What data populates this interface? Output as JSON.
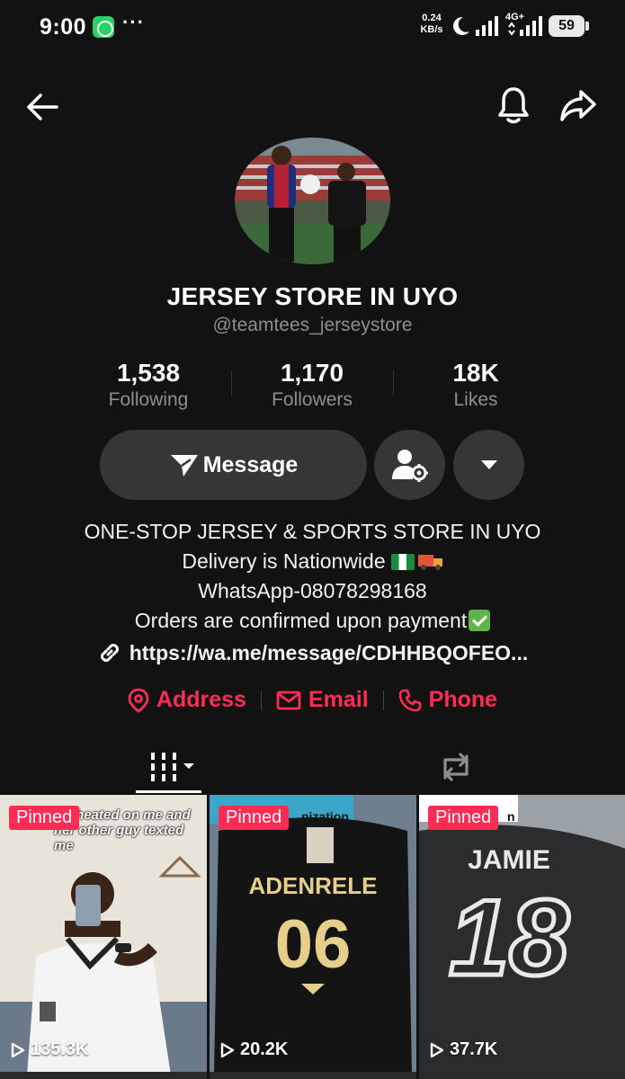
{
  "status_bar": {
    "time": "9:00",
    "more": "···",
    "speed_value": "0.24",
    "speed_unit": "KB/s",
    "network": "4G+",
    "battery": "59"
  },
  "profile": {
    "name": "JERSEY STORE IN UYO",
    "handle": "@teamtees_jerseystore"
  },
  "stats": [
    {
      "value": "1,538",
      "label": "Following"
    },
    {
      "value": "1,170",
      "label": "Followers"
    },
    {
      "value": "18K",
      "label": "Likes"
    }
  ],
  "actions": {
    "message_label": "Message"
  },
  "bio": {
    "line1": "ONE-STOP JERSEY & SPORTS STORE IN UYO",
    "line2": "Delivery is Nationwide",
    "line3": "WhatsApp-08078298168",
    "line4": "Orders are confirmed upon payment",
    "link": "https://wa.me/message/CDHHBQOFEO..."
  },
  "contacts": [
    {
      "label": "Address",
      "icon": "location-pin-icon"
    },
    {
      "label": "Email",
      "icon": "envelope-icon"
    },
    {
      "label": "Phone",
      "icon": "phone-icon"
    }
  ],
  "videos": [
    {
      "badge": "Pinned",
      "views": "135.3K",
      "caption": "d Cheated on me and her other guy texted me"
    },
    {
      "badge": "Pinned",
      "views": "20.2K",
      "caption": "nization",
      "jersey_name": "ADENRELE",
      "jersey_number": "06"
    },
    {
      "badge": "Pinned",
      "views": "37.7K",
      "caption": "n",
      "jersey_name": "JAMIE",
      "jersey_number": "18"
    }
  ],
  "colors": {
    "background": "#121212",
    "accent": "#fe2c55",
    "button": "#363636",
    "secondary_text": "#8e8e8e"
  }
}
